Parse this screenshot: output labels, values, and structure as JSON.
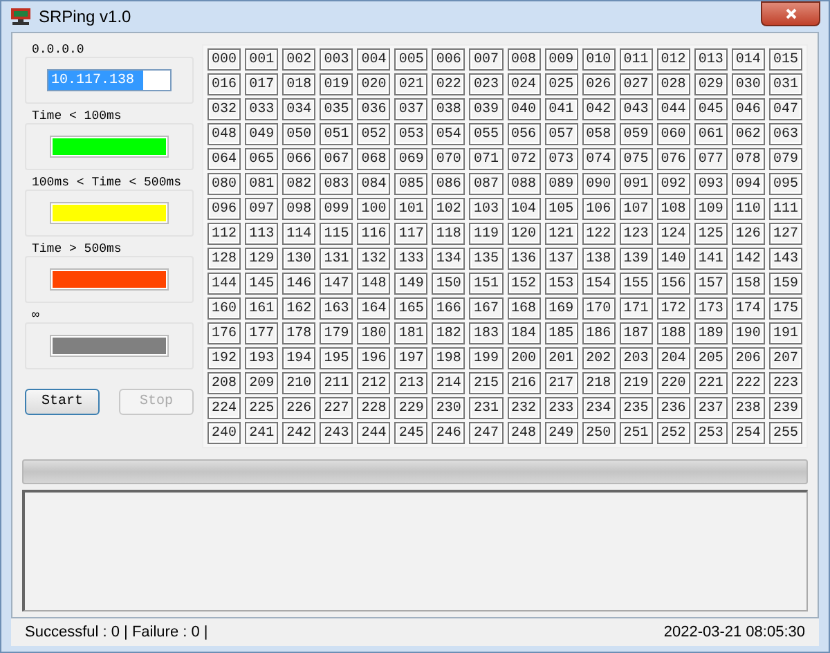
{
  "window": {
    "title": "SRPing v1.0"
  },
  "ip_group": {
    "label": "0.0.0.0",
    "value": "10.117.138"
  },
  "legend": [
    {
      "label": "Time < 100ms",
      "color": "#00ff00"
    },
    {
      "label": "100ms < Time < 500ms",
      "color": "#ffff00"
    },
    {
      "label": "Time > 500ms",
      "color": "#ff4400"
    },
    {
      "label": "∞",
      "color": "#808080"
    }
  ],
  "buttons": [
    {
      "label": "Start",
      "disabled": false
    },
    {
      "label": "Stop",
      "disabled": true
    }
  ],
  "hosts": [
    "000",
    "001",
    "002",
    "003",
    "004",
    "005",
    "006",
    "007",
    "008",
    "009",
    "010",
    "011",
    "012",
    "013",
    "014",
    "015",
    "016",
    "017",
    "018",
    "019",
    "020",
    "021",
    "022",
    "023",
    "024",
    "025",
    "026",
    "027",
    "028",
    "029",
    "030",
    "031",
    "032",
    "033",
    "034",
    "035",
    "036",
    "037",
    "038",
    "039",
    "040",
    "041",
    "042",
    "043",
    "044",
    "045",
    "046",
    "047",
    "048",
    "049",
    "050",
    "051",
    "052",
    "053",
    "054",
    "055",
    "056",
    "057",
    "058",
    "059",
    "060",
    "061",
    "062",
    "063",
    "064",
    "065",
    "066",
    "067",
    "068",
    "069",
    "070",
    "071",
    "072",
    "073",
    "074",
    "075",
    "076",
    "077",
    "078",
    "079",
    "080",
    "081",
    "082",
    "083",
    "084",
    "085",
    "086",
    "087",
    "088",
    "089",
    "090",
    "091",
    "092",
    "093",
    "094",
    "095",
    "096",
    "097",
    "098",
    "099",
    "100",
    "101",
    "102",
    "103",
    "104",
    "105",
    "106",
    "107",
    "108",
    "109",
    "110",
    "111",
    "112",
    "113",
    "114",
    "115",
    "116",
    "117",
    "118",
    "119",
    "120",
    "121",
    "122",
    "123",
    "124",
    "125",
    "126",
    "127",
    "128",
    "129",
    "130",
    "131",
    "132",
    "133",
    "134",
    "135",
    "136",
    "137",
    "138",
    "139",
    "140",
    "141",
    "142",
    "143",
    "144",
    "145",
    "146",
    "147",
    "148",
    "149",
    "150",
    "151",
    "152",
    "153",
    "154",
    "155",
    "156",
    "157",
    "158",
    "159",
    "160",
    "161",
    "162",
    "163",
    "164",
    "165",
    "166",
    "167",
    "168",
    "169",
    "170",
    "171",
    "172",
    "173",
    "174",
    "175",
    "176",
    "177",
    "178",
    "179",
    "180",
    "181",
    "182",
    "183",
    "184",
    "185",
    "186",
    "187",
    "188",
    "189",
    "190",
    "191",
    "192",
    "193",
    "194",
    "195",
    "196",
    "197",
    "198",
    "199",
    "200",
    "201",
    "202",
    "203",
    "204",
    "205",
    "206",
    "207",
    "208",
    "209",
    "210",
    "211",
    "212",
    "213",
    "214",
    "215",
    "216",
    "217",
    "218",
    "219",
    "220",
    "221",
    "222",
    "223",
    "224",
    "225",
    "226",
    "227",
    "228",
    "229",
    "230",
    "231",
    "232",
    "233",
    "234",
    "235",
    "236",
    "237",
    "238",
    "239",
    "240",
    "241",
    "242",
    "243",
    "244",
    "245",
    "246",
    "247",
    "248",
    "249",
    "250",
    "251",
    "252",
    "253",
    "254",
    "255"
  ],
  "progress": {
    "level": 0
  },
  "status_bar": {
    "counts": "Successful : 0 |  Failure : 0 |",
    "datetime": "2022-03-21 08:05:30"
  }
}
